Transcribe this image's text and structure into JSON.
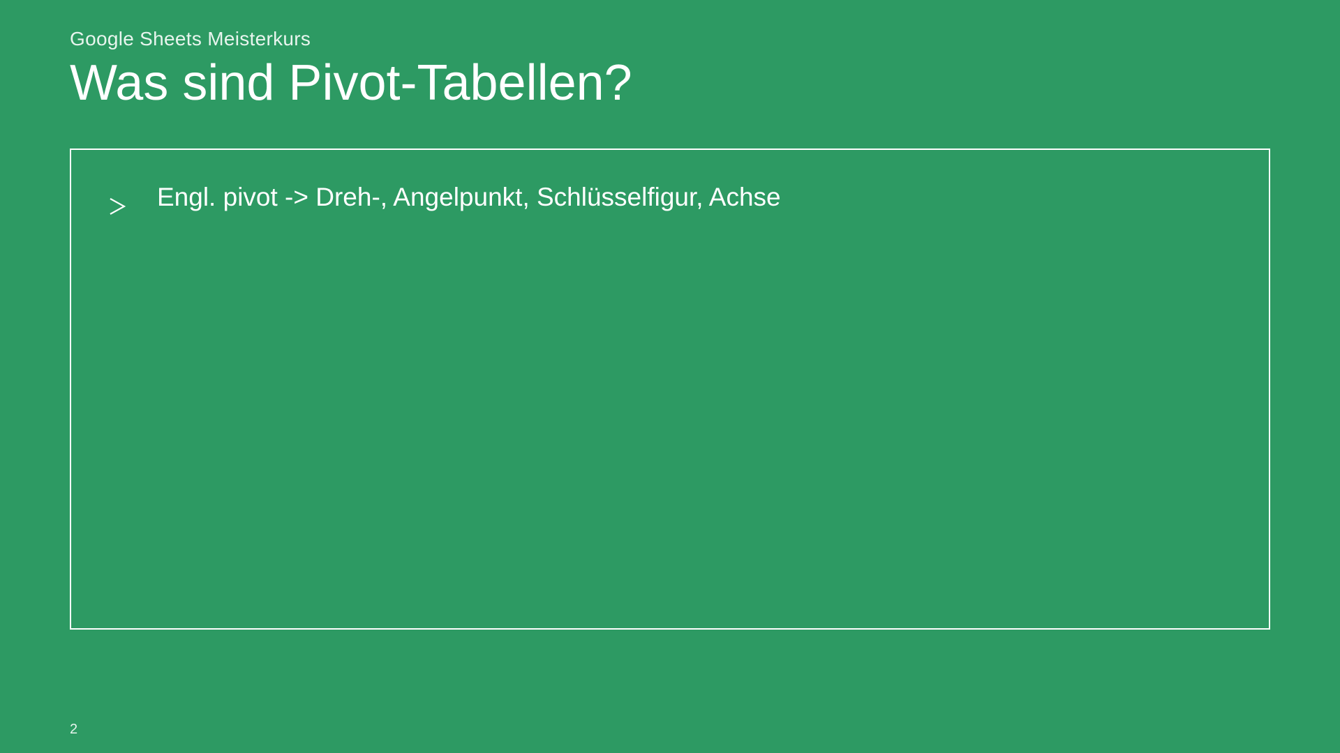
{
  "header": {
    "subtitle": "Google Sheets Meisterkurs",
    "title": "Was sind Pivot-Tabellen?"
  },
  "content": {
    "bullets": [
      {
        "text": "Engl. pivot -> Dreh-, Angelpunkt, Schlüsselfigur, Achse"
      }
    ]
  },
  "footer": {
    "page_number": "2"
  }
}
